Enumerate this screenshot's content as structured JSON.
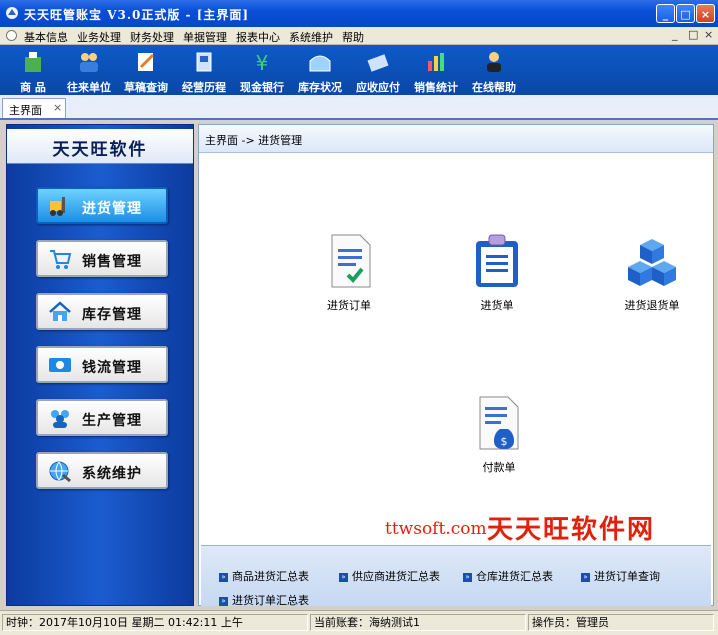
{
  "window": {
    "title": "天天旺管账宝 V3.0正式版 - [主界面]"
  },
  "menu": [
    "基本信息",
    "业务处理",
    "财务处理",
    "单据管理",
    "报表中心",
    "系统维护",
    "帮助"
  ],
  "mdi_controls": [
    "_",
    "□",
    "×"
  ],
  "toolbar": [
    "商 品",
    "往来单位",
    "草稿查询",
    "经营历程",
    "现金银行",
    "库存状况",
    "应收应付",
    "销售统计",
    "在线帮助"
  ],
  "tab": {
    "label": "主界面",
    "close": "×"
  },
  "sidebar": {
    "brand": "天天旺软件",
    "items": [
      {
        "label": "进货管理",
        "icon": "forklift-icon",
        "active": true
      },
      {
        "label": "销售管理",
        "icon": "shopping-cart-icon",
        "active": false
      },
      {
        "label": "库存管理",
        "icon": "house-icon",
        "active": false
      },
      {
        "label": "钱流管理",
        "icon": "money-flow-icon",
        "active": false
      },
      {
        "label": "生产管理",
        "icon": "users-group-icon",
        "active": false
      },
      {
        "label": "系统维护",
        "icon": "globe-wrench-icon",
        "active": false
      }
    ]
  },
  "main": {
    "breadcrumb": "主界面 -> 进货管理",
    "modules": [
      {
        "label": "进货订单",
        "icon": "order-document-icon"
      },
      {
        "label": "进货单",
        "icon": "clipboard-icon"
      },
      {
        "label": "进货退货单",
        "icon": "cubes-icon"
      },
      {
        "label": "付款单",
        "icon": "money-bag-document-icon"
      }
    ]
  },
  "watermark": {
    "url": "ttwsoft.com",
    "brand": "天天旺软件网"
  },
  "reports": [
    "商品进货汇总表",
    "供应商进货汇总表",
    "仓库进货汇总表",
    "进货订单查询",
    "进货订单汇总表"
  ],
  "status": {
    "clock_label": "时钟：",
    "clock_value": "2017年10月10日 星期二 01:42:11 上午",
    "account_label": "当前账套：",
    "account_value": "海纳测试1",
    "operator_label": "操作员：",
    "operator_value": "管理员"
  },
  "colors": {
    "titlebar": "#0a4fd8",
    "toolbar": "#0a47a8",
    "sidebar": "#1a5cd0",
    "watermark": "#e0220c"
  }
}
